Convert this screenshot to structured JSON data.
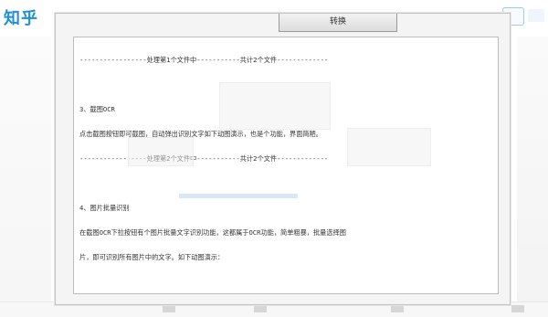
{
  "background_app": {
    "logo": "知乎",
    "accent_color": "#1f8fd8"
  },
  "dialog": {
    "convert_button_label": "转换",
    "log_lines": [
      "-----------------处理第1个文件中-----------共计2个文件-------------",
      "",
      "3、截图OCR",
      "点击截图按钮即可截图，自动弹出识别文字如下动图演示，也是个功能，界面简陋。",
      "-----------------处理第2个文件中-----------共计2个文件-------------",
      "",
      "4、图片批量识别",
      "在截图OCR下拉按钮有个图片批量文字识别功能，这都属于OCR功能，简单粗暴，批量选择图",
      "片，即可识别所有图片中的文字。如下动图演示："
    ]
  }
}
